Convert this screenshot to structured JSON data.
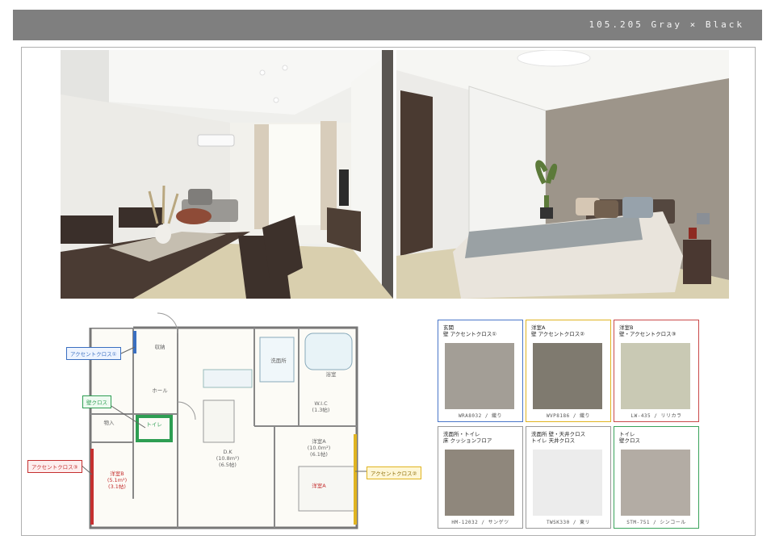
{
  "header": {
    "code": "105.205 Gray × Black"
  },
  "photos": [
    {
      "name": "living-dining-photo"
    },
    {
      "name": "bedroom-photo"
    }
  ],
  "floorplan": {
    "callouts": [
      {
        "id": "co1",
        "text": "アクセントクロス①",
        "color": "#3a6fc1"
      },
      {
        "id": "co2",
        "text": "壁クロス",
        "color": "#2e9e53"
      },
      {
        "id": "co3",
        "text": "アクセントクロス③",
        "color": "#c53030"
      },
      {
        "id": "co4",
        "text": "アクセントクロス②",
        "color": "#d4a20a"
      }
    ],
    "rooms": {
      "closet": "収納",
      "hall": "ホール",
      "wash": "洗面所",
      "bath": "浴室",
      "wic": "W.I.C\n(1.3帖)",
      "ldk": "D.K\n(10.8m²)\n(6.5帖)",
      "western_b": "洋室B\n(5.1m²)\n(3.1帖)",
      "western_a": "洋室A\n(10.0m²)\n(6.1帖)",
      "western_a_tag": "洋室A",
      "storage": "物入",
      "toilet": "トイレ"
    }
  },
  "swatches": [
    {
      "label": "玄関\n壁 アクセントクロス①",
      "code": "WRA8032 / 織り",
      "border": "#4a77c9",
      "fill": "#a39e96"
    },
    {
      "label": "洋室A\n壁 アクセントクロス②",
      "code": "WVP8186 / 織り",
      "border": "#e0b421",
      "fill": "#7f7a6f"
    },
    {
      "label": "洋室B\n壁・アクセントクロス③",
      "code": "LW-435 / リリカラ",
      "border": "#c94a4a",
      "fill": "#c9c9b4"
    },
    {
      "label": "洗面所・トイレ\n床 クッションフロア",
      "code": "HM-12032 / サンゲツ",
      "border": "#9a9a9a",
      "fill": "#8f877c"
    },
    {
      "label": "洗面所 壁・天井クロス\nトイレ 天井クロス",
      "code": "TWSK330 / 東リ",
      "border": "#9a9a9a",
      "fill": "#ececec"
    },
    {
      "label": "トイレ\n壁クロス",
      "code": "STM-751 / シンコール",
      "border": "#3aa35b",
      "fill": "#b3aca4"
    }
  ]
}
